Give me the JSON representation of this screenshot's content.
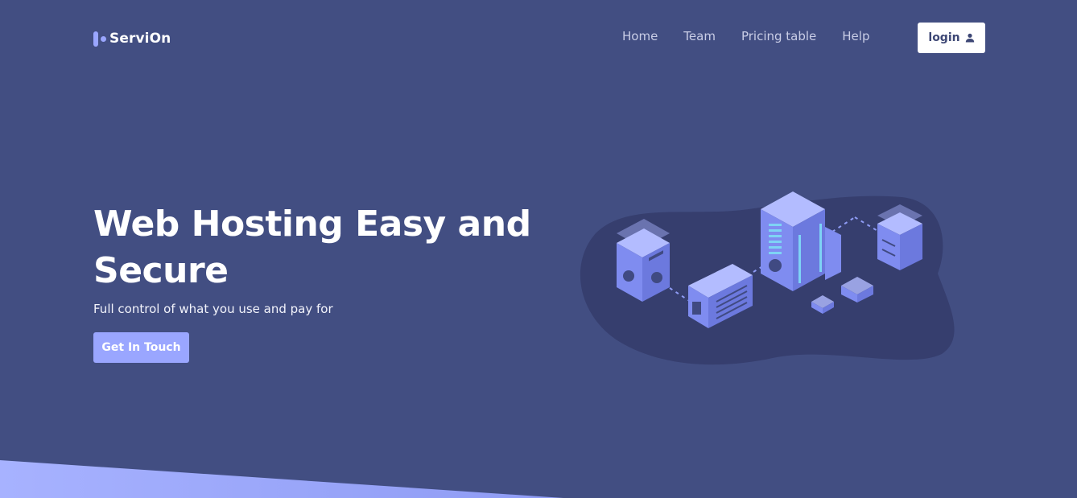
{
  "brand": {
    "name": "ServiOn",
    "accent": "#9aa6ff",
    "background": "#424e82"
  },
  "nav": {
    "links": [
      {
        "label": "Home"
      },
      {
        "label": "Team"
      },
      {
        "label": "Pricing table"
      },
      {
        "label": "Help"
      }
    ],
    "login_label": "login",
    "login_icon": "user-icon"
  },
  "hero": {
    "title": "Web Hosting Easy and Secure",
    "subtitle": "Full control of what you use and pay for",
    "cta_label": "Get In Touch"
  },
  "illustration": {
    "icon": "server-network-illustration"
  }
}
